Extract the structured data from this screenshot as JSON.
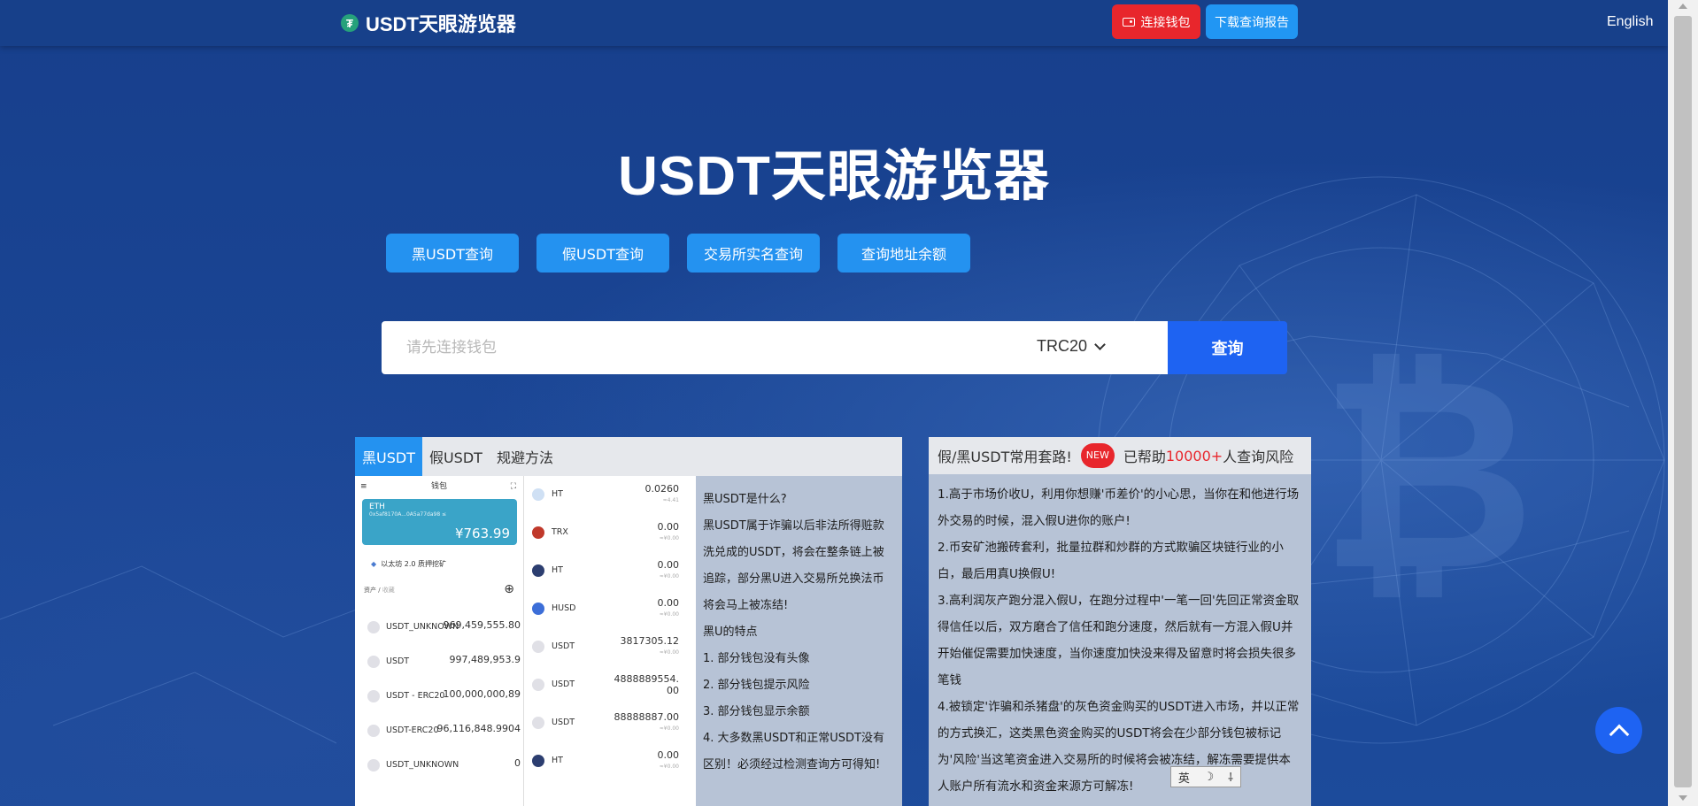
{
  "header": {
    "logo_text": "USDT天眼游览器",
    "connect_wallet": "连接钱包",
    "download_report": "下载查询报告",
    "language": "English"
  },
  "hero": {
    "title": "USDT天眼游览器"
  },
  "query_buttons": [
    "黑USDT查询",
    "假USDT查询",
    "交易所实名查询",
    "查询地址余额"
  ],
  "search": {
    "placeholder": "请先连接钱包",
    "chain": "TRC20",
    "button": "查询"
  },
  "left_panel": {
    "tabs": [
      "黑USDT",
      "假USDT",
      "规避方法"
    ],
    "phone1": {
      "title": "钱包",
      "card_label": "ETH",
      "card_addr": "0x5af8170A...0A5a77da98 ≤",
      "card_amount": "¥763.99",
      "stake_label": "以太坊 2.0 质押挖矿",
      "tab_assets": "资产",
      "tab_collect": "收藏",
      "rows": [
        {
          "name": "USDT_UNKNOWN",
          "value": "969,459,555.80"
        },
        {
          "name": "USDT",
          "value": "997,489,953.9"
        },
        {
          "name": "USDT - ERC20",
          "value": "100,000,000,89"
        },
        {
          "name": "USDT-ERC20",
          "value": "96,116,848.9904"
        },
        {
          "name": "USDT_UNKNOWN",
          "value": "0"
        }
      ]
    },
    "phone2": {
      "rows": [
        {
          "name": "HT",
          "value": "0.0260",
          "sub": "≈4.41"
        },
        {
          "name": "TRX",
          "value": "0.00",
          "sub": "≈¥0.00"
        },
        {
          "name": "HT",
          "value": "0.00",
          "sub": "≈¥0.00"
        },
        {
          "name": "HUSD",
          "value": "0.00",
          "sub": "≈¥0.00"
        },
        {
          "name": "USDT",
          "value": "3817305.12",
          "sub": "≈¥0.00"
        },
        {
          "name": "USDT",
          "value": "4888889554.00",
          "sub": "≈¥0.00"
        },
        {
          "name": "USDT",
          "value": "88888887.00",
          "sub": "≈¥0.00"
        },
        {
          "name": "HT",
          "value": "0.00",
          "sub": "≈¥0.00"
        }
      ]
    },
    "info": {
      "heading": "黑USDT是什么?",
      "desc": "黑USDT属于诈骗以后非法所得赃款洗兑成的USDT，将会在整条链上被追踪，部分黑U进入交易所兑换法币将会马上被冻结!",
      "features_title": "黑U的特点",
      "features": [
        "1. 部分钱包没有头像",
        "2. 部分钱包提示风险",
        "3. 部分钱包显示余额",
        "4. 大多数黑USDT和正常USDT没有区别！必须经过检测查询方可得知!"
      ]
    }
  },
  "right_panel": {
    "head_prefix": "假/黑USDT常用套路!",
    "badge": "NEW",
    "head_helped": "已帮助",
    "head_count": "10000+",
    "head_suffix": "人查询风险",
    "items": [
      "1.高于市场价收U，利用你想赚'币差价'的小心思，当你在和他进行场外交易的时候，混入假U进你的账户!",
      "2.币安矿池搬砖套利，批量拉群和炒群的方式欺骗区块链行业的小白，最后用真U换假U!",
      "3.高利润灰产跑分混入假U，在跑分过程中'一笔一回'先回正常资金取得信任以后，双方磨合了信任和跑分速度，然后就有一方混入假U并开始催促需要加快速度，当你速度加快没来得及留意时将会损失很多笔钱",
      "4.被锁定'诈骗和杀猪盘'的灰色资金购买的USDT进入市场，并以正常的方式换汇，这类黑色资金购买的USDT将会在少部分钱包被标记为'风险'当这笔资金进入交易所的时候将会被冻结，解冻需要提供本人账户所有流水和资金来源方可解冻!"
    ]
  },
  "ime": {
    "label1": "英",
    "label2": "☽",
    "label3": "⸸"
  },
  "colors": {
    "accent_blue": "#2492f0",
    "primary_blue": "#1e63f2",
    "red": "#e8262c",
    "bg": "#1a4594"
  }
}
